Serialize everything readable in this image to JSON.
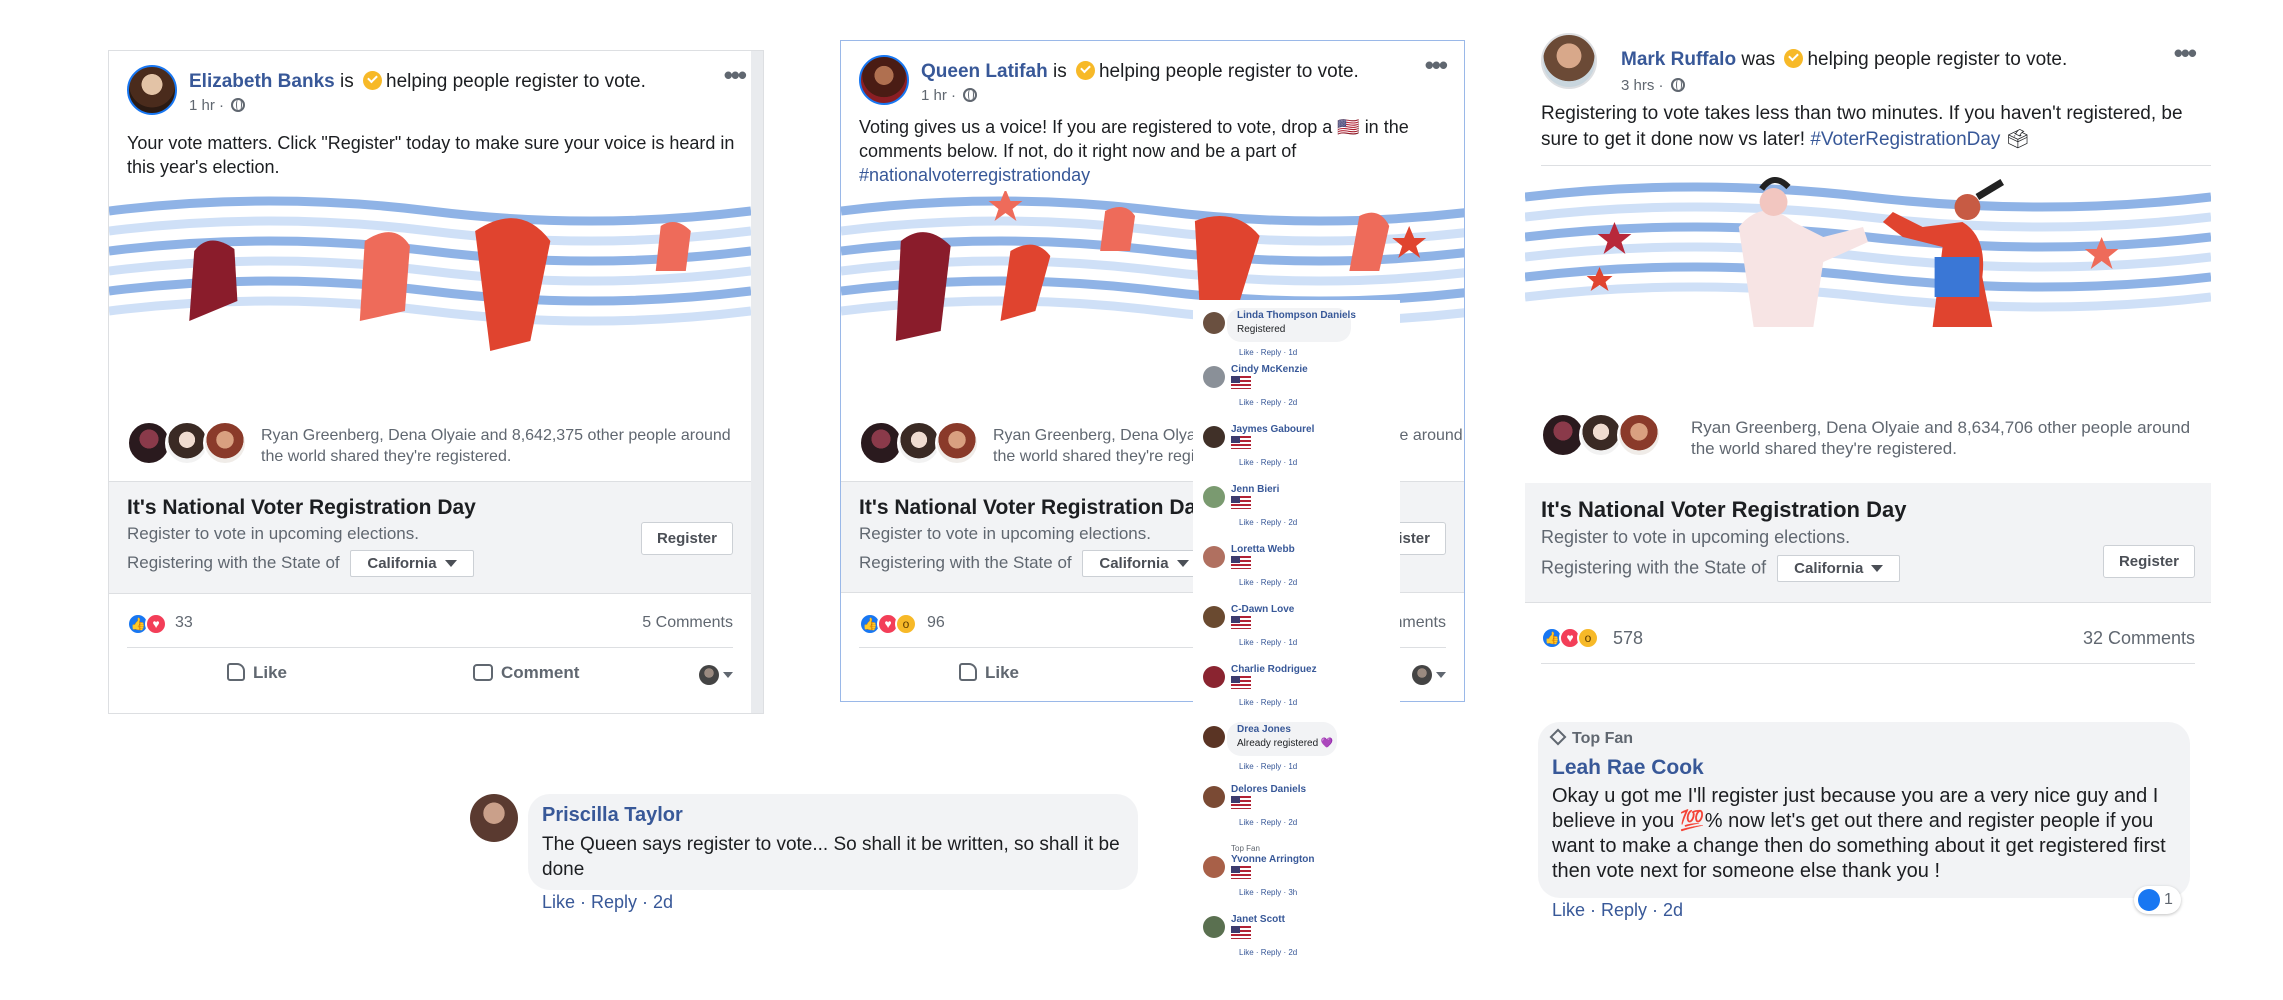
{
  "colors": {
    "link": "#385898",
    "facebook_blue": "#1877f2",
    "muted": "#606770",
    "flag_red": "#b22234",
    "flag_blue": "#3c3b6e"
  },
  "posts": [
    {
      "author": "Elizabeth Banks",
      "verb": "is",
      "activity": "helping people register to vote.",
      "time": "1 hr ·",
      "text": "Your vote matters. Click \"Register\" today to make sure your voice is heard in this year's election.",
      "sharers": "Ryan Greenberg, Dena Olyaie and 8,642,375 other people around the world shared they're registered.",
      "cta": {
        "title": "It's National Voter Registration Day",
        "subtitle": "Register to vote in upcoming elections.",
        "state_prefix": "Registering with the State of",
        "state": "California",
        "button": "Register"
      },
      "reaction_count": "33",
      "comments": "5 Comments",
      "actions": {
        "like": "Like",
        "comment": "Comment"
      }
    },
    {
      "author": "Queen Latifah",
      "verb": "is",
      "activity": "helping people register to vote.",
      "time": "1 hr ·",
      "text_before": "Voting gives us a voice! If you are registered to vote, drop a 🇺🇸 in the comments below. If not, do it right now and be a part of",
      "hashtag": "#nationalvoterregistrationday",
      "sharers": "Ryan Greenberg, Dena Olyaie and 8,642,375 other people around the world shared they're registered.",
      "cta": {
        "title": "It's National Voter Registration Day",
        "subtitle": "Register to vote in upcoming elections.",
        "state_prefix": "Registering with the State of",
        "state": "California",
        "button": "Register"
      },
      "reaction_count": "96",
      "comments": "Comments",
      "actions": {
        "like": "Like"
      }
    },
    {
      "author": "Mark Ruffalo",
      "verb": "was",
      "activity": "helping people register to vote.",
      "time": "3 hrs ·",
      "text_before": "Registering to vote takes less than two minutes. If you haven't registered, be sure to get it done now vs later!",
      "hashtag": "#VoterRegistrationDay",
      "sharers": "Ryan Greenberg, Dena Olyaie and 8,634,706 other people around the world shared they're registered.",
      "cta": {
        "title": "It's National Voter Registration Day",
        "subtitle": "Register to vote in upcoming elections.",
        "state_prefix": "Registering with the State of",
        "state": "California",
        "button": "Register"
      },
      "reaction_count": "578",
      "comments": "32 Comments"
    }
  ],
  "comment_strip": [
    {
      "name": "Linda Thompson Daniels",
      "text": "Registered",
      "meta": "Like · Reply · 1d"
    },
    {
      "name": "Cindy McKenzie",
      "flag": "🇺🇸",
      "meta": "Like · Reply · 2d"
    },
    {
      "name": "Jaymes Gabourel",
      "flag": "🇺🇸",
      "meta": "Like · Reply · 1d"
    },
    {
      "name": "Jenn Bieri",
      "flag": "🇺🇸",
      "meta": "Like · Reply · 2d"
    },
    {
      "name": "Loretta Webb",
      "flag": "🇺🇸",
      "meta": "Like · Reply · 2d"
    },
    {
      "name": "C-Dawn Love",
      "flag": "🇺🇸",
      "meta": "Like · Reply · 1d"
    },
    {
      "name": "Charlie Rodriguez",
      "flag": "🇺🇸",
      "meta": "Like · Reply · 1d"
    },
    {
      "name": "Drea Jones",
      "text": "Already registered 💜",
      "meta": "Like · Reply · 1d"
    },
    {
      "name": "Delores Daniels",
      "flag": "🇺🇸",
      "meta": "Like · Reply · 2d"
    },
    {
      "name": "Yvonne Arrington",
      "tag": "Top Fan",
      "flag": "🇺🇸",
      "meta": "Like · Reply · 3h"
    },
    {
      "name": "Janet Scott",
      "flag": "🇺🇸",
      "meta": "Like · Reply · 2d"
    }
  ],
  "comment_priscilla": {
    "name": "Priscilla Taylor",
    "text": "The Queen says register to vote... So shall it be written, so shall it be done",
    "actions": "Like · Reply · 2d"
  },
  "comment_leah": {
    "badge": "Top Fan",
    "name": "Leah Rae Cook",
    "text": "Okay u got me I'll register just because you are a very nice guy and I believe in you 💯% now let's get out there and register people if you want to make a change then do something about it get registered first then vote next for someone else thank you !",
    "actions": "Like · Reply · 2d",
    "like_count": "1"
  }
}
